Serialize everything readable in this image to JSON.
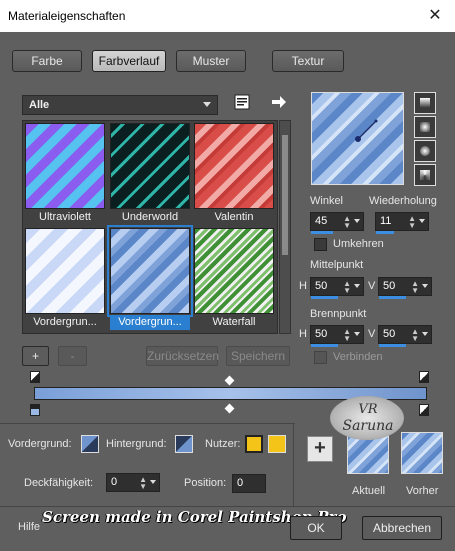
{
  "window": {
    "title": "Materialeigenschaften",
    "close_glyph": "✕"
  },
  "tabs": [
    {
      "label": "Farbe",
      "active": false
    },
    {
      "label": "Farbverlauf",
      "active": true
    },
    {
      "label": "Muster",
      "active": false
    },
    {
      "label": "Textur",
      "active": false
    }
  ],
  "gallery": {
    "category": "Alle",
    "items": [
      {
        "label": "Ultraviolett",
        "colors": [
          "#8b5cf0",
          "#56c2ef"
        ]
      },
      {
        "label": "Underworld",
        "colors": [
          "#0b1f20",
          "#2fb5a8"
        ]
      },
      {
        "label": "Valentin",
        "colors": [
          "#d94d48",
          "#f1aaa6"
        ]
      },
      {
        "label": "Vordergrun...",
        "colors": [
          "#c9d8f6",
          "#f4f7fd"
        ]
      },
      {
        "label": "Vordergrun...",
        "colors": [
          "#5b87c9",
          "#b7cef0"
        ],
        "selected": true
      },
      {
        "label": "Waterfall",
        "colors": [
          "#3f8f35",
          "#f0f0f0"
        ]
      }
    ]
  },
  "settings": {
    "angle_label": "Winkel",
    "angle_value": "45",
    "repeat_label": "Wiederholung",
    "repeat_value": "11",
    "invert_label": "Umkehren",
    "center_label": "Mittelpunkt",
    "center_h": "50",
    "center_v": "50",
    "focus_label": "Brennpunkt",
    "focus_h": "50",
    "focus_v": "50",
    "link_label": "Verbinden",
    "h_label": "H",
    "v_label": "V"
  },
  "buttons": {
    "add": "+",
    "remove": "-",
    "reset": "Zurücksetzen",
    "save": "Speichern",
    "ok": "OK",
    "cancel": "Abbrechen",
    "help": "Hilfe",
    "plus": "+"
  },
  "stops": {
    "foreground_label": "Vordergrund:",
    "background_label": "Hintergrund:",
    "user_label": "Nutzer:",
    "opacity_label": "Deckfähigkeit:",
    "opacity_value": "0",
    "position_label": "Position:",
    "position_value": "0",
    "user_color_1": "#f4c419",
    "user_color_2": "#f4c419"
  },
  "previews": {
    "current_label": "Aktuell",
    "previous_label": "Vorher"
  },
  "watermark": {
    "badge_line1": "VR",
    "badge_line2": "Saruna",
    "credit": "Screen made in Corel Paintshop Pro"
  },
  "colors": {
    "accent": "#2b7fd0",
    "panel": "#5f5f5f",
    "gradient_start": "#7a9fd8",
    "gradient_end": "#6f93cc"
  }
}
